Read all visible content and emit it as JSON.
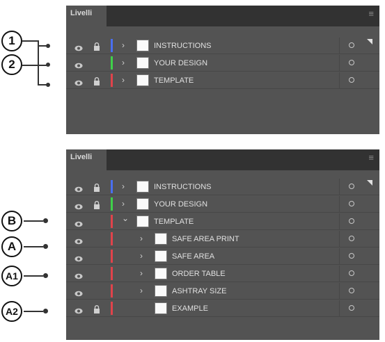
{
  "callouts": [
    {
      "label": "1"
    },
    {
      "label": "2"
    },
    {
      "label": "B"
    },
    {
      "label": "A"
    },
    {
      "label": "A1"
    },
    {
      "label": "A2"
    }
  ],
  "panel_title": "Livelli",
  "menu_icon": "hamburger-menu-icon",
  "colors": {
    "blue": "#4a6ff0",
    "green": "#3fd14a",
    "red": "#e0434b"
  },
  "top_panel": {
    "layers": [
      {
        "name": "INSTRUCTIONS",
        "visible": true,
        "locked": true,
        "color": "#4a6ff0",
        "expanded": false
      },
      {
        "name": "YOUR DESIGN",
        "visible": true,
        "locked": false,
        "color": "#3fd14a",
        "expanded": false
      },
      {
        "name": "TEMPLATE",
        "visible": true,
        "locked": true,
        "color": "#e0434b",
        "expanded": false
      }
    ]
  },
  "bottom_panel": {
    "layers": [
      {
        "name": "INSTRUCTIONS",
        "visible": true,
        "locked": true,
        "color": "#4a6ff0",
        "expanded": false
      },
      {
        "name": "YOUR DESIGN",
        "visible": true,
        "locked": true,
        "color": "#3fd14a",
        "expanded": false
      },
      {
        "name": "TEMPLATE",
        "visible": true,
        "locked": false,
        "color": "#e0434b",
        "expanded": true
      },
      {
        "name": "SAFE AREA PRINT",
        "visible": true,
        "locked": false,
        "color": "#e0434b",
        "expanded": false,
        "sublayer": true
      },
      {
        "name": "SAFE AREA",
        "visible": true,
        "locked": false,
        "color": "#e0434b",
        "expanded": false,
        "sublayer": true
      },
      {
        "name": "ORDER TABLE",
        "visible": true,
        "locked": false,
        "color": "#e0434b",
        "expanded": false,
        "sublayer": true
      },
      {
        "name": "ASHTRAY SIZE",
        "visible": true,
        "locked": false,
        "color": "#e0434b",
        "expanded": false,
        "sublayer": true
      },
      {
        "name": "EXAMPLE",
        "visible": true,
        "locked": true,
        "color": "#e0434b",
        "expanded": false,
        "sublayer": true
      }
    ]
  }
}
